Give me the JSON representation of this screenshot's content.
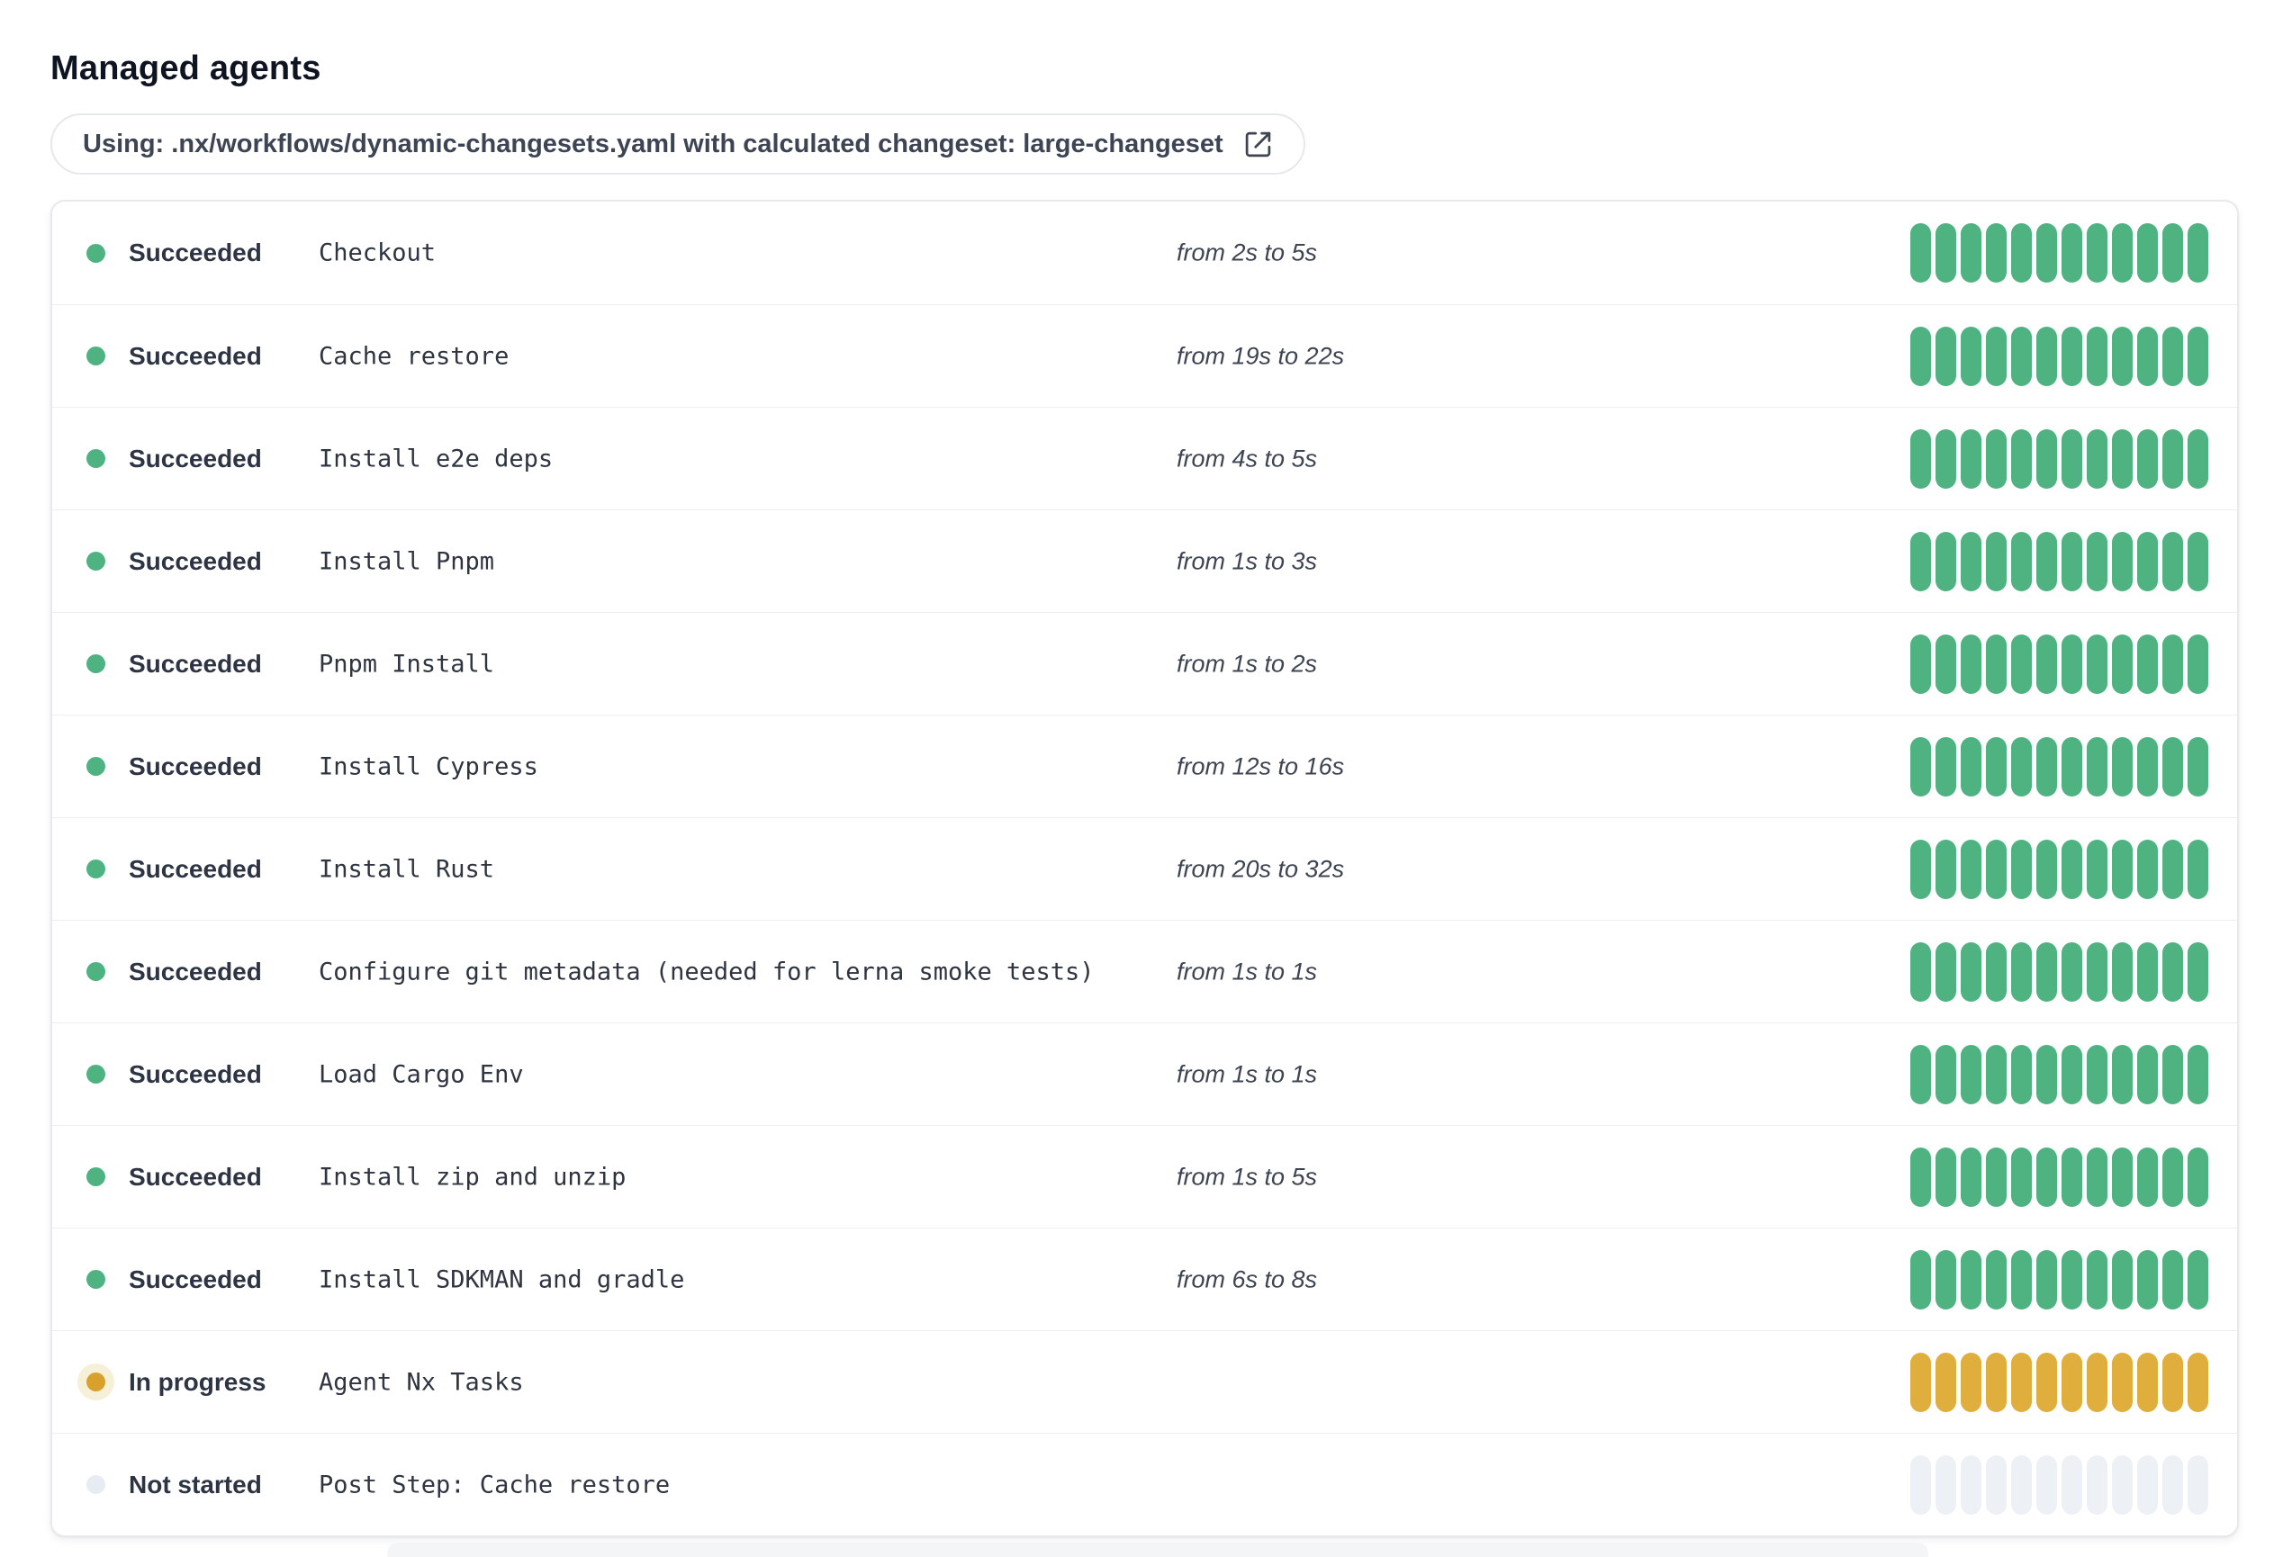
{
  "page": {
    "title": "Managed agents"
  },
  "banner": {
    "text": "Using: .nx/workflows/dynamic-changesets.yaml with calculated changeset: large-changeset",
    "icon": "external-link-icon"
  },
  "colors": {
    "succeeded": "#4fb381",
    "in_progress": "#e0ae3c",
    "not_started": "#edf1f6",
    "in_progress_dot": "#d7a12b",
    "in_progress_halo": "#f7f0d9",
    "not_started_dot": "#e7ecf2"
  },
  "agents": {
    "pill_count": 12,
    "rows": [
      {
        "status": "succeeded",
        "status_label": "Succeeded",
        "name": "Checkout",
        "duration": "from 2s to 5s"
      },
      {
        "status": "succeeded",
        "status_label": "Succeeded",
        "name": "Cache restore",
        "duration": "from 19s to 22s"
      },
      {
        "status": "succeeded",
        "status_label": "Succeeded",
        "name": "Install e2e deps",
        "duration": "from 4s to 5s"
      },
      {
        "status": "succeeded",
        "status_label": "Succeeded",
        "name": "Install Pnpm",
        "duration": "from 1s to 3s"
      },
      {
        "status": "succeeded",
        "status_label": "Succeeded",
        "name": "Pnpm Install",
        "duration": "from 1s to 2s"
      },
      {
        "status": "succeeded",
        "status_label": "Succeeded",
        "name": "Install Cypress",
        "duration": "from 12s to 16s"
      },
      {
        "status": "succeeded",
        "status_label": "Succeeded",
        "name": "Install Rust",
        "duration": "from 20s to 32s"
      },
      {
        "status": "succeeded",
        "status_label": "Succeeded",
        "name": "Configure git metadata (needed for lerna smoke tests)",
        "duration": "from 1s to 1s"
      },
      {
        "status": "succeeded",
        "status_label": "Succeeded",
        "name": "Load Cargo Env",
        "duration": "from 1s to 1s"
      },
      {
        "status": "succeeded",
        "status_label": "Succeeded",
        "name": "Install zip and unzip",
        "duration": "from 1s to 5s"
      },
      {
        "status": "succeeded",
        "status_label": "Succeeded",
        "name": "Install SDKMAN and gradle",
        "duration": "from 6s to 8s"
      },
      {
        "status": "in-progress",
        "status_label": "In progress",
        "name": "Agent Nx Tasks",
        "duration": ""
      },
      {
        "status": "not-started",
        "status_label": "Not started",
        "name": "Post Step: Cache restore",
        "duration": ""
      }
    ]
  }
}
